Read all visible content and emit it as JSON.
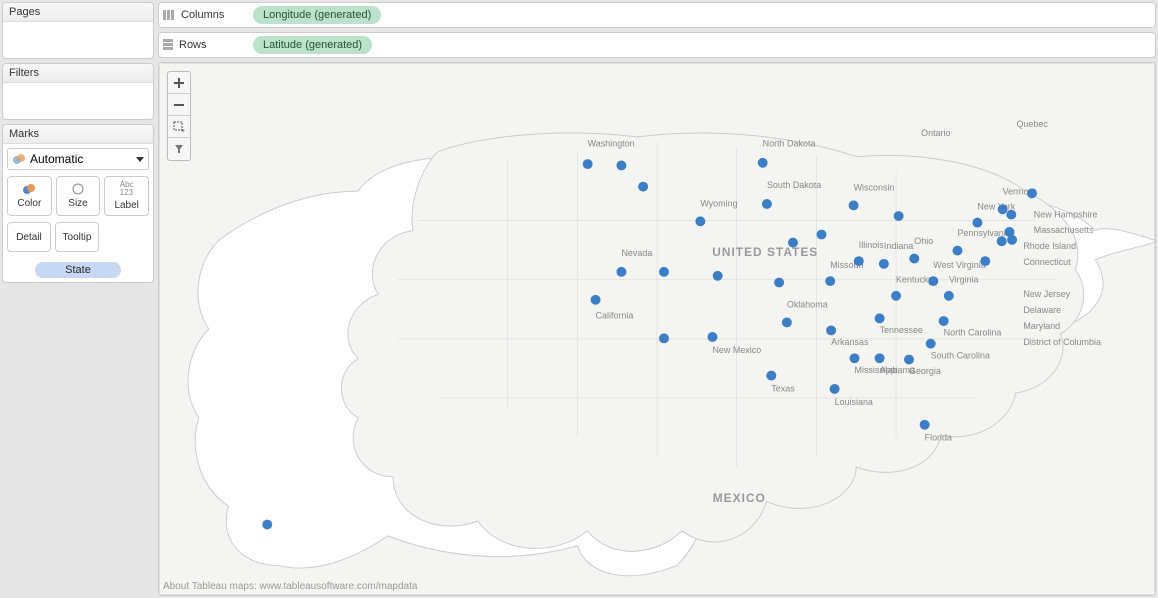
{
  "panels": {
    "pages": "Pages",
    "filters": "Filters",
    "marks": "Marks"
  },
  "shelves": {
    "columns_label": "Columns",
    "rows_label": "Rows",
    "columns_pill": "Longitude (generated)",
    "rows_pill": "Latitude (generated)"
  },
  "marks_card": {
    "type": "Automatic",
    "color": "Color",
    "size": "Size",
    "label": "Label",
    "detail": "Detail",
    "tooltip": "Tooltip",
    "state_pill": "State"
  },
  "map": {
    "credit": "About Tableau maps: www.tableausoftware.com/mapdata",
    "country_big": [
      "UNITED STATES",
      "MEXICO"
    ],
    "place_labels": [
      "Washington",
      "North Dakota",
      "South Dakota",
      "Wyoming",
      "Nevada",
      "California",
      "New Mexico",
      "Oklahoma",
      "Arkansas",
      "Texas",
      "Louisiana",
      "Mississippi",
      "Alabama",
      "Wisconsin",
      "Illinois",
      "Indiana",
      "Missouri",
      "Tennessee",
      "South Carolina",
      "Georgia",
      "Florida",
      "Kentucky",
      "West Virginia",
      "Virginia",
      "North Carolina",
      "Pennsylvania",
      "Delaware",
      "Maryland",
      "District of Columbia",
      "New Jersey",
      "Connecticut",
      "Rhode Island",
      "Massachusetts",
      "New Hampshire",
      "Vermont",
      "New York",
      "Ohio",
      "Ontario",
      "Quebec"
    ],
    "dots_lonlat": [
      [
        -120.5,
        47.4
      ],
      [
        -116.6,
        47.3
      ],
      [
        -114.1,
        45.7
      ],
      [
        -100.3,
        47.5
      ],
      [
        -107.5,
        43.1
      ],
      [
        -99.8,
        44.4
      ],
      [
        -111.7,
        39.3
      ],
      [
        -116.6,
        39.3
      ],
      [
        -105.5,
        39.0
      ],
      [
        -98.4,
        38.5
      ],
      [
        -96.8,
        41.5
      ],
      [
        -93.5,
        42.1
      ],
      [
        -92.5,
        38.6
      ],
      [
        -89.2,
        40.1
      ],
      [
        -86.3,
        39.9
      ],
      [
        -82.8,
        40.3
      ],
      [
        -89.8,
        44.3
      ],
      [
        -84.6,
        43.5
      ],
      [
        -77.8,
        40.9
      ],
      [
        -74.6,
        40.1
      ],
      [
        -72.7,
        41.6
      ],
      [
        -71.5,
        41.7
      ],
      [
        -71.8,
        42.3
      ],
      [
        -71.6,
        43.6
      ],
      [
        -72.6,
        44.0
      ],
      [
        -75.5,
        43.0
      ],
      [
        -69.2,
        45.2
      ],
      [
        -80.6,
        38.6
      ],
      [
        -78.8,
        37.5
      ],
      [
        -84.9,
        37.5
      ],
      [
        -86.8,
        35.8
      ],
      [
        -79.4,
        35.6
      ],
      [
        -80.9,
        33.9
      ],
      [
        -83.4,
        32.7
      ],
      [
        -86.8,
        32.8
      ],
      [
        -89.7,
        32.8
      ],
      [
        -92.4,
        34.9
      ],
      [
        -97.5,
        35.5
      ],
      [
        -106.1,
        34.4
      ],
      [
        -111.7,
        34.3
      ],
      [
        -99.3,
        31.5
      ],
      [
        -92.0,
        30.5
      ],
      [
        -81.6,
        27.8
      ],
      [
        -119.6,
        37.2
      ],
      [
        -157.5,
        20.3
      ]
    ]
  },
  "toolbar_icons": {
    "zoom_in": "+",
    "zoom_out": "−",
    "zoom_area": "⬚",
    "pin": "📌"
  }
}
